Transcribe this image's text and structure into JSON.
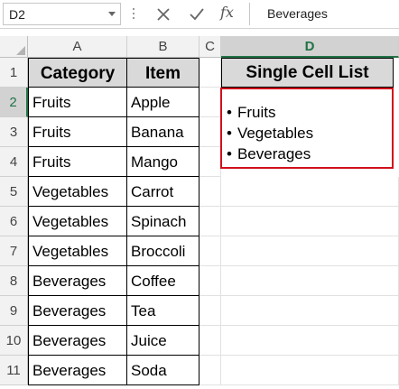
{
  "formula_bar": {
    "name_box": "D2",
    "formula": "Beverages",
    "fx_label": "fx"
  },
  "columns": [
    "A",
    "B",
    "C",
    "D"
  ],
  "selected_column": "D",
  "rows": [
    "1",
    "2",
    "3",
    "4",
    "5",
    "6",
    "7",
    "8",
    "9",
    "10",
    "11"
  ],
  "selected_row": "2",
  "table": {
    "headers": [
      "Category",
      "Item"
    ],
    "rows": [
      [
        "Fruits",
        "Apple"
      ],
      [
        "Fruits",
        "Banana"
      ],
      [
        "Fruits",
        "Mango"
      ],
      [
        "Vegetables",
        "Carrot"
      ],
      [
        "Vegetables",
        "Spinach"
      ],
      [
        "Vegetables",
        "Broccoli"
      ],
      [
        "Beverages",
        "Coffee"
      ],
      [
        "Beverages",
        "Tea"
      ],
      [
        "Beverages",
        "Juice"
      ],
      [
        "Beverages",
        "Soda"
      ]
    ]
  },
  "single_cell_list": {
    "header": "Single Cell List",
    "items": [
      "Fruits",
      "Vegetables",
      "Beverages"
    ]
  },
  "colors": {
    "selection_green": "#217346",
    "highlight_red": "#d0101b",
    "header_fill": "#d9d9d9"
  }
}
